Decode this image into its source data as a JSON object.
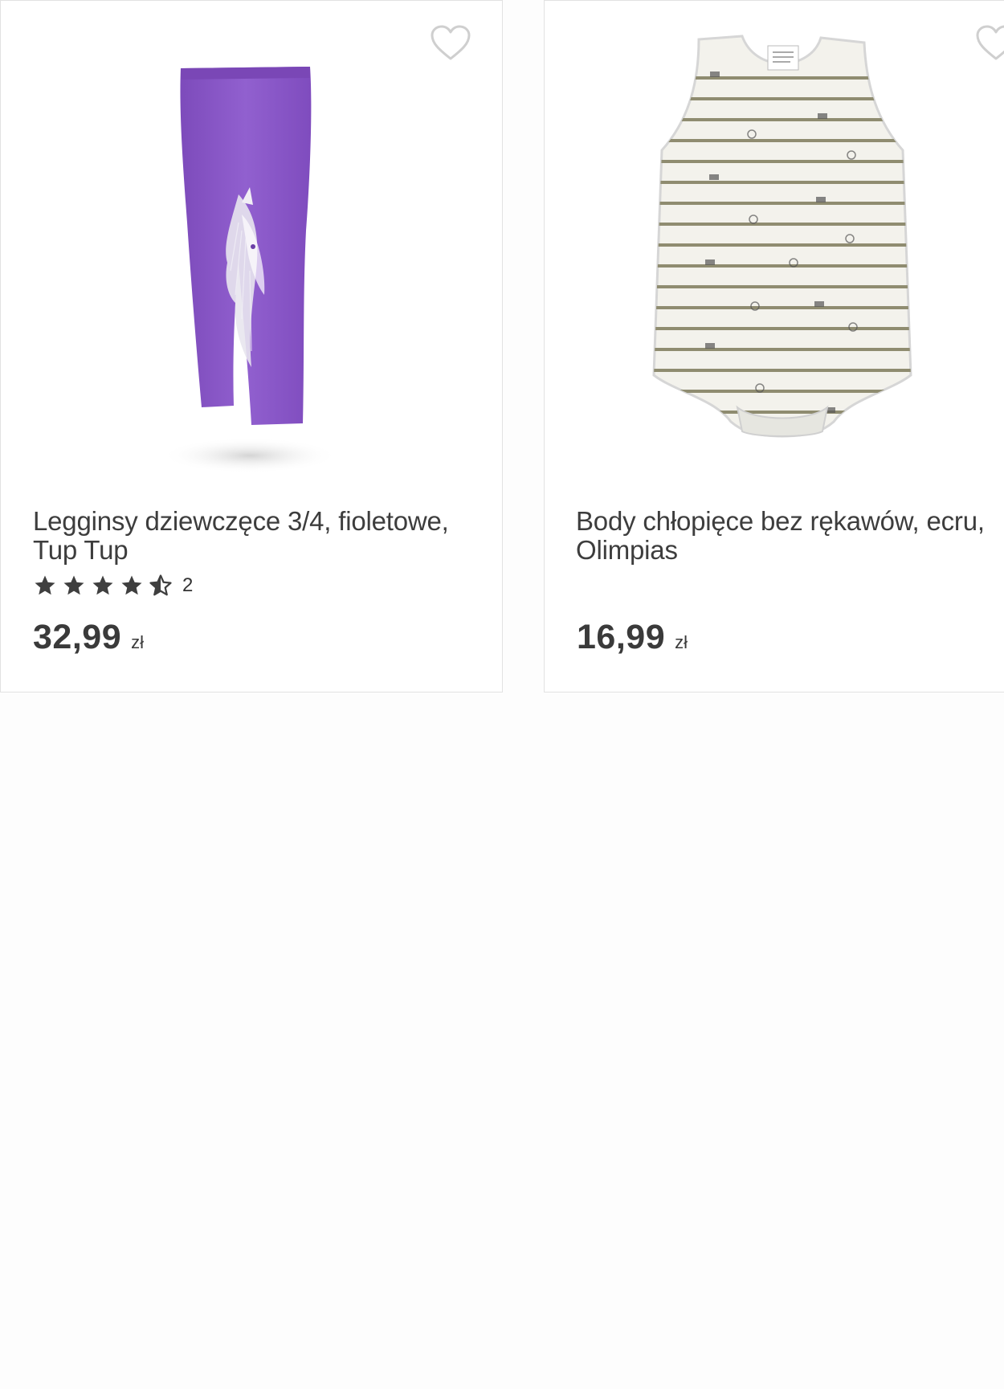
{
  "products": [
    {
      "title": "Legginsy dziewczęce 3/4, fioletowe, Tup Tup",
      "rating_stars": 4.5,
      "rating_count": "2",
      "price": "32,99",
      "currency": "zł",
      "image_icon": "leggings-image",
      "favorite_icon": "heart-outline-icon"
    },
    {
      "title": "Body chłopięce bez rękawów, ecru, Olimpias",
      "price": "16,99",
      "currency": "zł",
      "image_icon": "bodysuit-image",
      "favorite_icon": "heart-outline-icon"
    }
  ],
  "colors": {
    "leggings": "#8a55c6",
    "text": "#3a3a3a",
    "star": "#3f3f3f",
    "border": "#e2e2e2"
  }
}
